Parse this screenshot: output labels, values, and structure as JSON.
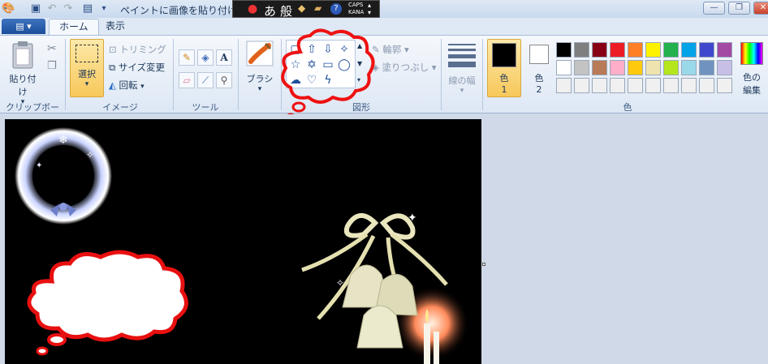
{
  "titlebar": {
    "title": "ペイントに画像を貼り付け",
    "ime": {
      "mode": "あ",
      "kanji": "般",
      "caps": "CAPS",
      "kana": "KANA"
    },
    "buttons": {
      "minimize": "—",
      "restore": "❐",
      "close": "✕"
    }
  },
  "tabs": {
    "app_menu": "▤ ▾",
    "home": "ホーム",
    "view": "表示"
  },
  "clipboard": {
    "paste": "貼り付け",
    "paste_arrow": "▾",
    "label": "クリップボード"
  },
  "image": {
    "select": "選択",
    "select_arrow": "▾",
    "crop": "トリミング",
    "resize": "サイズ変更",
    "rotate": "回転",
    "rotate_arrow": "▾",
    "label": "イメージ"
  },
  "tools": {
    "label": "ツール",
    "text_tool": "A"
  },
  "brush": {
    "label": "ブラシ",
    "arrow": "▾"
  },
  "shapes": {
    "outline": "輪郭",
    "fill": "塗りつぶし",
    "label": "図形"
  },
  "size": {
    "label": "線の幅"
  },
  "colors": {
    "color1": "色",
    "color1_num": "1",
    "color2": "色",
    "color2_num": "2",
    "edit": "色の",
    "edit2": "編集",
    "label": "色",
    "primary": "#000000",
    "secondary": "#ffffff",
    "palette": [
      [
        "#000000",
        "#7f7f7f",
        "#880015",
        "#ed1c24",
        "#ff7f27",
        "#fff200",
        "#22b14c",
        "#00a2e8",
        "#3f48cc",
        "#a349a4"
      ],
      [
        "#ffffff",
        "#c3c3c3",
        "#b97a57",
        "#ffaec9",
        "#ffc90e",
        "#efe4b0",
        "#b5e61d",
        "#99d9ea",
        "#7092be",
        "#c8bfe7"
      ],
      [
        "#f0f0f0",
        "#f0f0f0",
        "#f0f0f0",
        "#f0f0f0",
        "#f0f0f0",
        "#f0f0f0",
        "#f0f0f0",
        "#f0f0f0",
        "#f0f0f0",
        "#f0f0f0"
      ]
    ]
  },
  "accent": {
    "highlight": "#ff0000",
    "canvas_bg": "#000000"
  }
}
